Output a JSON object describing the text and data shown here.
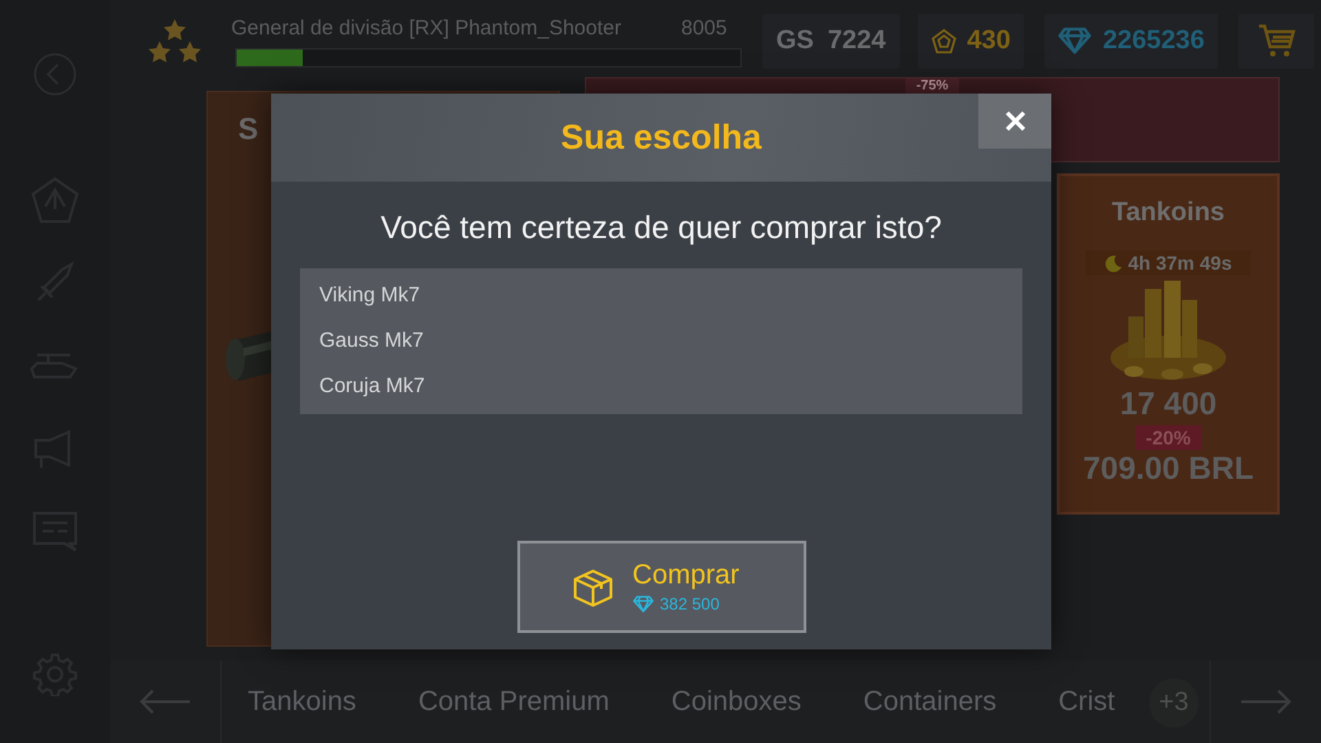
{
  "header": {
    "rank_name": "General de divisão [RX] Phantom_Shooter",
    "experience": "8005",
    "experience_bar": {
      "level": 0.13
    },
    "gs_label": "GS",
    "gs_value": "7224",
    "gold": "430",
    "diamonds": "2265236"
  },
  "offers": {
    "left_card": {
      "title": "S"
    },
    "banner": {
      "discount": "-75%"
    },
    "tankoins_card": {
      "title": "Tankoins",
      "timer": "4h 37m 49s",
      "amount": "17 400",
      "discount": "-20%",
      "price": "709.00 BRL"
    }
  },
  "tabs": [
    {
      "label": "Tankoins"
    },
    {
      "label": "Conta Premium"
    },
    {
      "label": "Coinboxes"
    },
    {
      "label": "Containers"
    },
    {
      "label": "Crist"
    }
  ],
  "more_tabs_badge": "+3",
  "dialog": {
    "title": "Sua escolha",
    "question": "Você tem certeza de quer comprar isto?",
    "items": [
      "Viking Mk7",
      "Gauss Mk7",
      "Coruja Mk7"
    ],
    "buy_button": {
      "label": "Comprar",
      "price": "382 500"
    }
  }
}
